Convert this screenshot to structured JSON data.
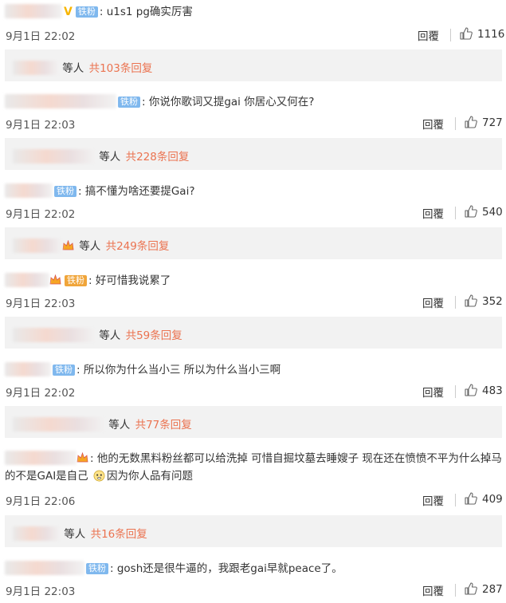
{
  "reply_label": "回覆",
  "reply_box_suffix": "等人",
  "comments": [
    {
      "badge": "铁粉",
      "text": "u1s1 pg确实厉害",
      "date": "9月1日 22:02",
      "likes": "1116",
      "replies": {
        "count_label": "共103条回复"
      }
    },
    {
      "badge": "铁粉",
      "text": "你说你歌词又提gai 你居心又何在?",
      "date": "9月1日 22:03",
      "likes": "727",
      "replies": {
        "count_label": "共228条回复"
      }
    },
    {
      "badge": "铁粉",
      "text": "搞不懂为啥还要提Gai?",
      "date": "9月1日 22:02",
      "likes": "540",
      "replies": {
        "count_label": "共249条回复"
      }
    },
    {
      "badge": "铁粉",
      "text": "好可惜我说累了",
      "date": "9月1日 22:03",
      "likes": "352",
      "replies": {
        "count_label": "共59条回复"
      }
    },
    {
      "badge": "铁粉",
      "text": "所以你为什么当小三 所以为什么当小三啊",
      "date": "9月1日 22:02",
      "likes": "483",
      "replies": {
        "count_label": "共77条回复"
      }
    },
    {
      "badge": "",
      "text_part1": "他的无数黑料粉丝都可以给洗掉 可惜自掘坟墓去睡嫂子 现在还在愤愤不平为什么掉马的不是GAI是自己",
      "text_part2": "因为你人品有问题",
      "date": "9月1日 22:06",
      "likes": "409",
      "replies": {
        "count_label": "共16条回复"
      }
    },
    {
      "badge": "铁粉",
      "text": "gosh还是很牛逼的，我跟老gai早就peace了。",
      "date": "9月1日 22:03",
      "likes": "287"
    }
  ],
  "colors": {
    "link": "#eb7350",
    "badge": "#7fb8ee",
    "reply_bg": "#f2f2f2"
  }
}
